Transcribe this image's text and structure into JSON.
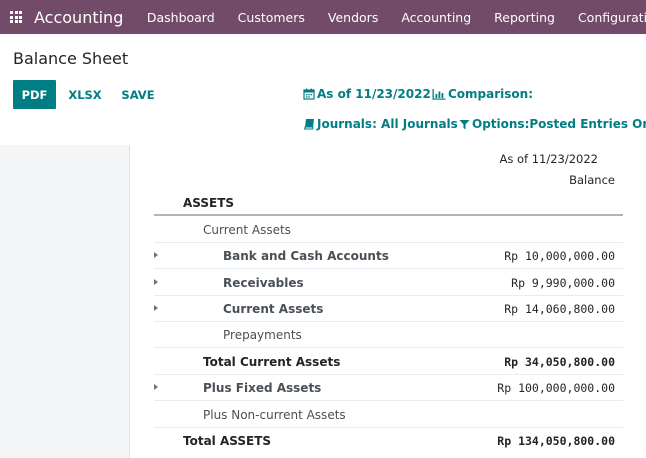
{
  "navbar": {
    "app_name": "Accounting",
    "menu": [
      "Dashboard",
      "Customers",
      "Vendors",
      "Accounting",
      "Reporting",
      "Configuration"
    ],
    "color": "#714b67"
  },
  "control_panel": {
    "title": "Balance Sheet",
    "buttons": {
      "pdf": "PDF",
      "xlsx": "XLSX",
      "save": "SAVE"
    },
    "filters": {
      "date": "As of 11/23/2022",
      "comparison": "Comparison:",
      "journals": "Journals: All Journals",
      "options": "Options:Posted Entries Only"
    },
    "accent_color": "#017e84"
  },
  "report": {
    "column_date": "As of 11/23/2022",
    "column_label": "Balance",
    "section": "ASSETS",
    "rows": [
      {
        "label": "Current Assets",
        "value": "",
        "expandable": false,
        "bold": false
      },
      {
        "label": "Bank and Cash Accounts",
        "value": "Rp 10,000,000.00",
        "expandable": true,
        "bold": true
      },
      {
        "label": "Receivables",
        "value": "Rp 9,990,000.00",
        "expandable": true,
        "bold": true
      },
      {
        "label": "Current Assets",
        "value": "Rp 14,060,800.00",
        "expandable": true,
        "bold": true
      },
      {
        "label": "Prepayments",
        "value": "",
        "expandable": false,
        "bold": false
      },
      {
        "label": "Total Current Assets",
        "value": "Rp 34,050,800.00",
        "expandable": false,
        "bold": true
      },
      {
        "label": "Plus Fixed Assets",
        "value": "Rp 100,000,000.00",
        "expandable": true,
        "bold": true
      },
      {
        "label": "Plus Non-current Assets",
        "value": "",
        "expandable": false,
        "bold": false
      },
      {
        "label": "Total ASSETS",
        "value": "Rp 134,050,800.00",
        "expandable": false,
        "bold": true
      }
    ]
  }
}
